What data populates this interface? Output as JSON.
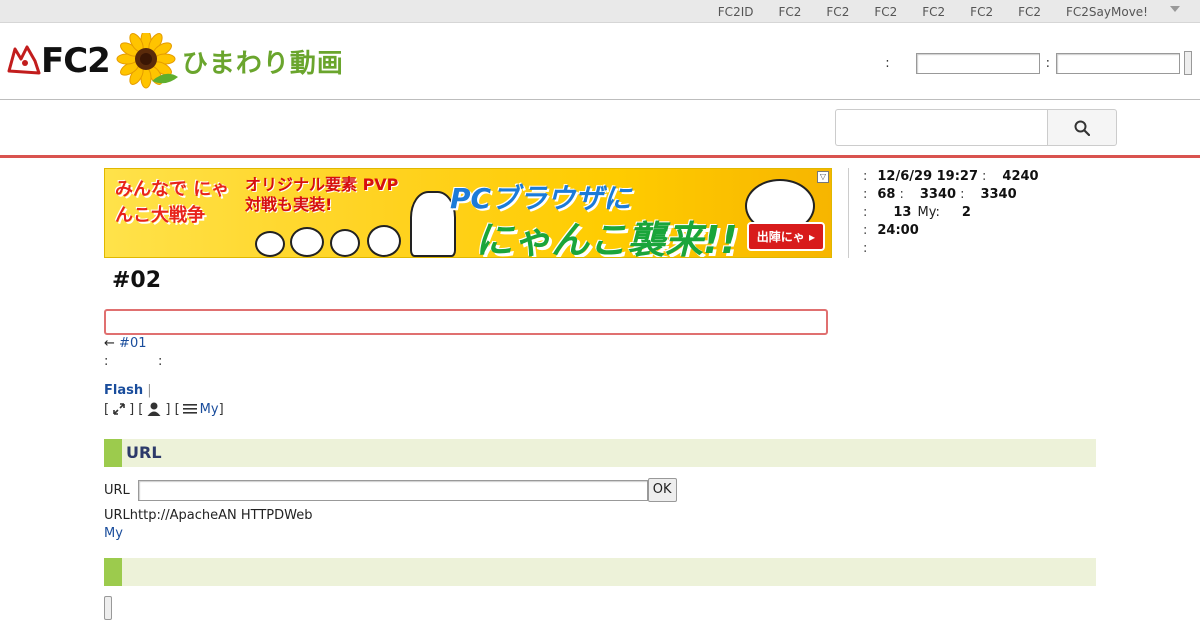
{
  "topnav": {
    "items": [
      "FC2ID",
      "FC2",
      "FC2",
      "FC2",
      "FC2",
      "FC2",
      "FC2",
      "FC2SayMove!"
    ]
  },
  "header": {
    "logo_text": "FC2",
    "logo_sub": "ひまわり動画",
    "login_colon_1": ":",
    "login_colon_2": ":"
  },
  "banner": {
    "line1": "みんなで にゃんこ大戦争",
    "line2": "オリジナル要素 PVP対戦も実装!",
    "line3": "PCブラウザに",
    "line4": "にゃんこ襲来!!",
    "cta": "出陣にゃ ▸"
  },
  "info": {
    "rows": [
      {
        "c": ":",
        "v1": "12/6/29 19:27",
        "c2": ":",
        "v2": "4240"
      },
      {
        "c": ":",
        "v1": "68",
        "c2": ":",
        "v2": "3340",
        "c3": ":",
        "v3": "3340"
      },
      {
        "c": ":",
        "v1": "13",
        "label": "My:",
        "v2": "2"
      },
      {
        "c": ":",
        "v1": "24:00"
      },
      {
        "c": ":"
      }
    ]
  },
  "video": {
    "title": "#02",
    "prev_arrow": "←",
    "prev_link": "#01",
    "meta": ":            :",
    "flash_label": "Flash",
    "flash_sep": "|",
    "my_label": "My"
  },
  "url_section": {
    "heading": "URL",
    "field_label": "URL",
    "ok_label": "OK",
    "note": "URLhttp://ApacheAN HTTPDWeb",
    "my_link": "My"
  },
  "colors": {
    "accent_red": "#d9534f",
    "section_green": "#9ccb4d",
    "section_bg": "#edf2d9",
    "link_blue": "#1a4d9c"
  }
}
